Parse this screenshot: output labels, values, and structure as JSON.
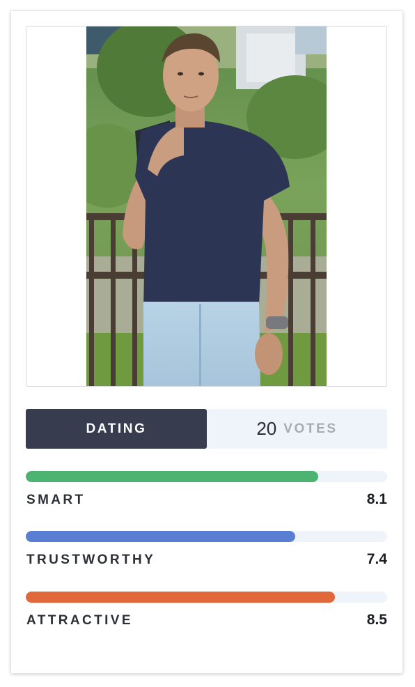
{
  "profile": {
    "photo_alt": "profile-photo",
    "category": "DATING",
    "votes_count": "20",
    "votes_label": "VOTES"
  },
  "metrics": [
    {
      "label": "SMART",
      "score": "8.1",
      "fill": 0.81,
      "color": "#4db371"
    },
    {
      "label": "TRUSTWORTHY",
      "score": "7.4",
      "fill": 0.746,
      "color": "#5a7fd2"
    },
    {
      "label": "ATTRACTIVE",
      "score": "8.5",
      "fill": 0.855,
      "color": "#e0683a"
    }
  ]
}
